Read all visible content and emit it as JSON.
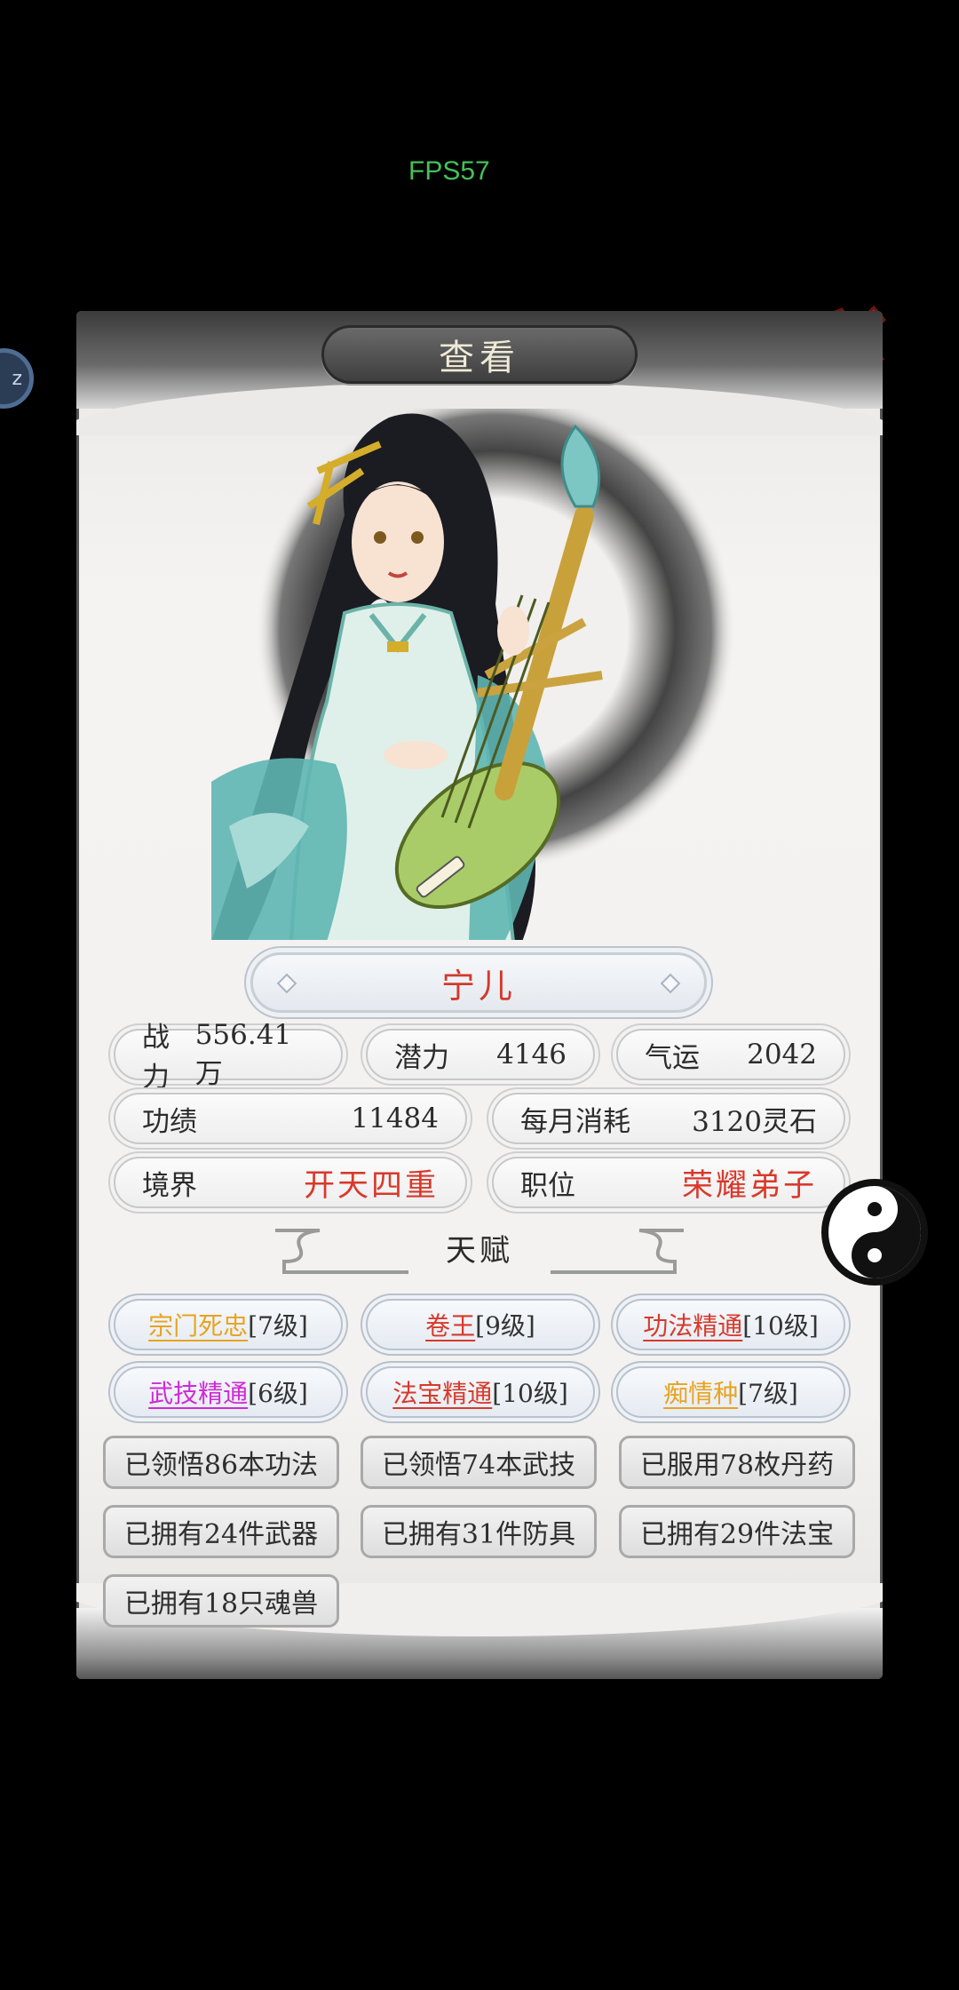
{
  "hud": {
    "fps": "FPS57"
  },
  "dialog": {
    "title": "查看",
    "character_name": "宁儿"
  },
  "stats": {
    "combat": {
      "label": "战力",
      "value": "556.41万"
    },
    "potential": {
      "label": "潜力",
      "value": "4146"
    },
    "luck": {
      "label": "气运",
      "value": "2042"
    },
    "merit": {
      "label": "功绩",
      "value": "11484"
    },
    "monthly": {
      "label": "每月消耗",
      "value": "3120灵石"
    },
    "realm": {
      "label": "境界",
      "value": "开天四重"
    },
    "position": {
      "label": "职位",
      "value": "荣耀弟子"
    }
  },
  "talents": {
    "header": "天赋",
    "items": [
      {
        "name": "宗门死忠",
        "level": "[7级]",
        "color": "#e8a31f"
      },
      {
        "name": "卷王",
        "level": "[9级]",
        "color": "#d8392b"
      },
      {
        "name": "功法精通",
        "level": "[10级]",
        "color": "#d8392b"
      },
      {
        "name": "武技精通",
        "level": "[6级]",
        "color": "#cf2ad6"
      },
      {
        "name": "法宝精通",
        "level": "[10级]",
        "color": "#d8392b"
      },
      {
        "name": "痴情种",
        "level": "[7级]",
        "color": "#e8a31f"
      }
    ]
  },
  "achievements": [
    "已领悟86本功法",
    "已领悟74本武技",
    "已服用78枚丹药",
    "已拥有24件武器",
    "已拥有31件防具",
    "已拥有29件法宝",
    "已拥有18只魂兽"
  ]
}
